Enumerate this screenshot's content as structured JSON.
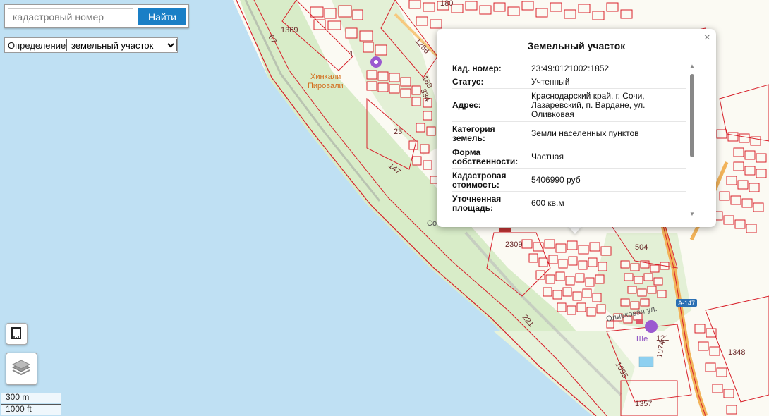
{
  "search": {
    "placeholder": "кадастровый номер",
    "button": "Найти"
  },
  "definition": {
    "label": "Определение:",
    "selected": "земельный участок"
  },
  "popup": {
    "title": "Земельный участок",
    "close": "×",
    "rows": [
      {
        "key": "Кад. номер:",
        "value": "23:49:0121002:1852"
      },
      {
        "key": "Статус:",
        "value": "Учтенный"
      },
      {
        "key": "Адрес:",
        "value": "Краснодарский край, г. Сочи, Лазаревский, п. Вардане, ул. Оливковая"
      },
      {
        "key": "Категория земель:",
        "value": "Земли населенных пунктов"
      },
      {
        "key": "Форма собственности:",
        "value": "Частная"
      },
      {
        "key": "Кадастровая стоимость:",
        "value": "5406990 руб"
      },
      {
        "key": "Уточненная площадь:",
        "value": "600 кв.м"
      }
    ]
  },
  "scale": {
    "metric": "300 m",
    "imperial": "1000 ft"
  },
  "map_labels": {
    "parcel_1369": "1369",
    "parcel_67": "67",
    "parcel_1266": "1266",
    "parcel_188": "188",
    "parcel_334": "334",
    "parcel_23": "23",
    "parcel_147": "147",
    "parcel_2309": "2309",
    "parcel_504": "504",
    "parcel_221": "221",
    "parcel_1095": "1095",
    "parcel_1074": "1074",
    "parcel_1348": "1348",
    "parcel_1357": "1357",
    "parcel_121": "121",
    "parcel_180": "180",
    "parcel_1": "1",
    "poi_hinkali": "Хинкали",
    "poi_pirovali": "Пировали",
    "poi_she": "Ше",
    "road_a147": "А-147",
    "street_olivkovaya": "Оливковая ул.",
    "coast_label": "Со"
  },
  "colors": {
    "sea": "#bfe0f3",
    "land": "#fbfaf3",
    "green": "#d8ecc8",
    "parcel": "#d8202a",
    "button": "#1a7fc6",
    "road_orange": "#f2b35a"
  }
}
